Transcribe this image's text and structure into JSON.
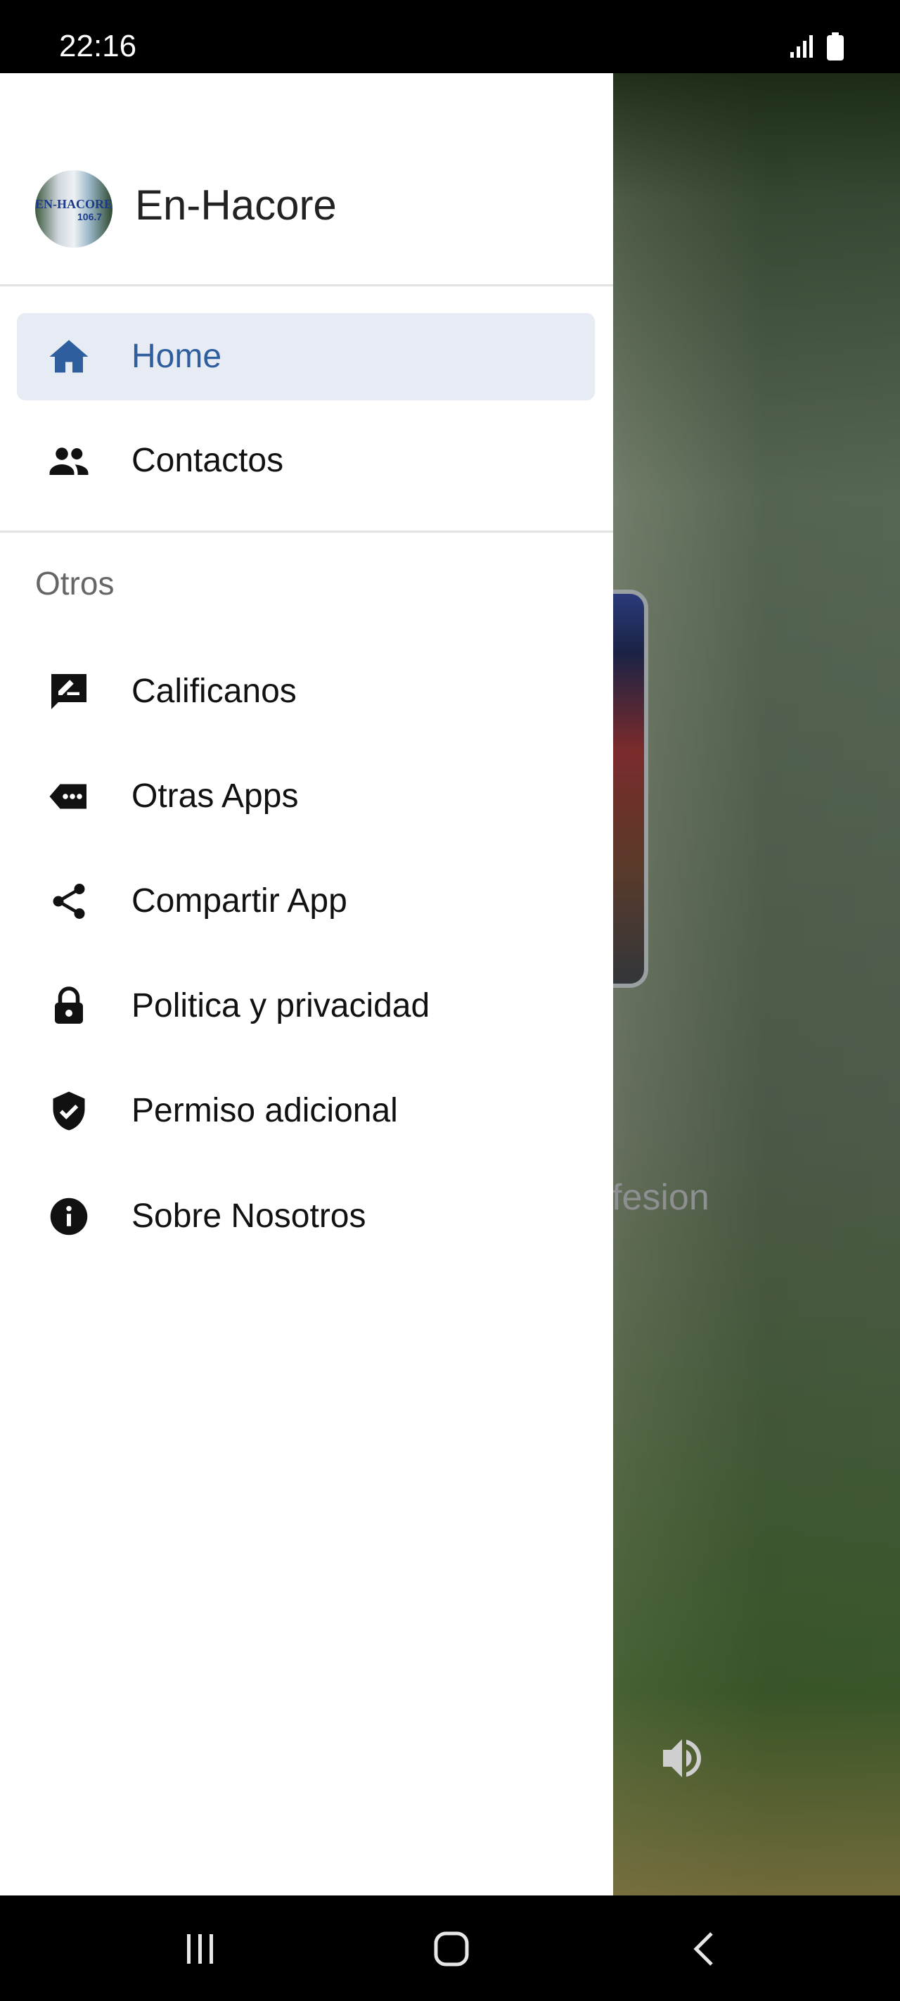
{
  "status_bar": {
    "time": "22:16"
  },
  "background": {
    "partial_text": "fesion"
  },
  "drawer": {
    "app_name": "En-Hacore",
    "logo_text": "EN-HACORE",
    "logo_subtext": "106.7",
    "primary_items": [
      {
        "label": "Home",
        "icon": "home-icon",
        "active": true
      },
      {
        "label": "Contactos",
        "icon": "people-icon",
        "active": false
      }
    ],
    "section_title": "Otros",
    "other_items": [
      {
        "label": "Calificanos",
        "icon": "rate-review-icon"
      },
      {
        "label": "Otras Apps",
        "icon": "more-apps-icon"
      },
      {
        "label": "Compartir App",
        "icon": "share-icon"
      },
      {
        "label": "Politica y privacidad",
        "icon": "lock-icon"
      },
      {
        "label": "Permiso adicional",
        "icon": "verified-shield-icon"
      },
      {
        "label": "Sobre Nosotros",
        "icon": "info-icon"
      }
    ]
  },
  "colors": {
    "accent": "#2e5e9e",
    "active_bg": "#e6ebf4"
  }
}
